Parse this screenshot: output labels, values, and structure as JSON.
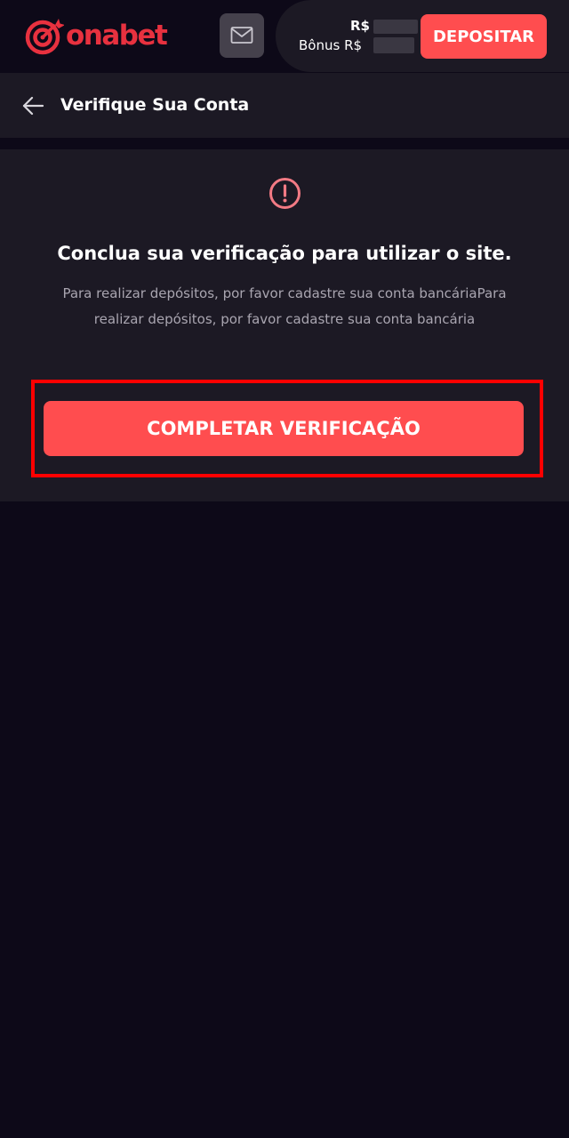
{
  "header": {
    "logo_text": "onabet",
    "balance_label": "R$",
    "bonus_label": "Bônus R$",
    "deposit_label": "DEPOSITAR"
  },
  "subheader": {
    "title": "Verifique Sua Conta"
  },
  "verification": {
    "title": "Conclua sua verificação para utilizar o site.",
    "description": "Para realizar depósitos, por favor cadastre sua conta bancáriaPara realizar depósitos, por favor cadastre sua conta bancária",
    "button_label": "COMPLETAR VERIFICAÇÃO"
  },
  "icons": {
    "logo": "onabet-target-logo",
    "mail": "mail-icon",
    "back": "arrow-left-icon",
    "alert": "exclamation-circle-icon"
  },
  "colors": {
    "background": "#0d0918",
    "surface": "#1c1924",
    "accent": "#ff4d4f",
    "brand": "#e8313f",
    "highlight": "#ff0000",
    "alert_icon": "#f27a84"
  }
}
